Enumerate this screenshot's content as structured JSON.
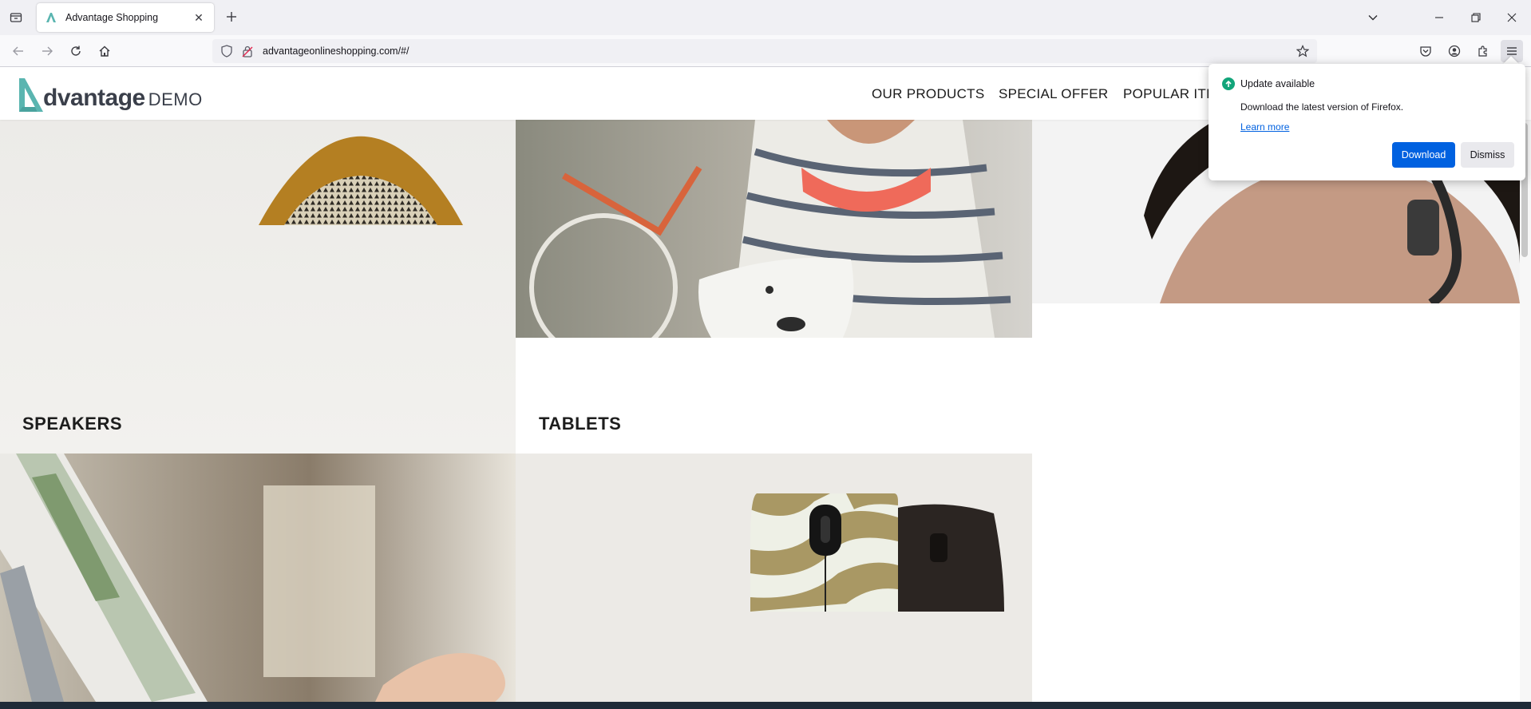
{
  "browser": {
    "tab": {
      "title": "Advantage Shopping"
    },
    "url": "advantageonlineshopping.com/#/"
  },
  "site": {
    "logo": {
      "word": "dvantage",
      "demo": "DEMO"
    },
    "nav": [
      "OUR PRODUCTS",
      "SPECIAL OFFER",
      "POPULAR ITEM"
    ]
  },
  "categories": [
    {
      "label": "SPEAKERS"
    },
    {
      "label": "TABLETS"
    }
  ],
  "update_popup": {
    "title": "Update available",
    "body": "Download the latest version of Firefox.",
    "link": "Learn more",
    "download_label": "Download",
    "dismiss_label": "Dismiss"
  },
  "colors": {
    "brand_teal": "#5ab5b0",
    "firefox_blue": "#0061e0",
    "update_green": "#12a57a"
  }
}
